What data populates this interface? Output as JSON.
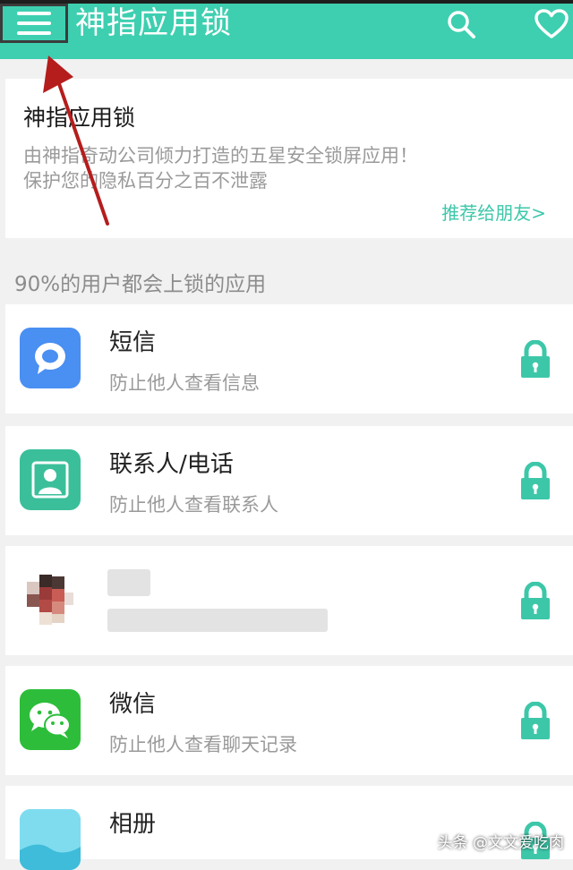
{
  "header": {
    "title": "神指应用锁",
    "menu_icon": "menu-icon",
    "search_icon": "search-icon",
    "heart_icon": "heart-icon",
    "background_color": "#3dcfb0"
  },
  "intro": {
    "title": "神指应用锁",
    "description": "由神指奇动公司倾力打造的五星安全锁屏应用！\n保护您的隐私百分之百不泄露",
    "share_link": "推荐给朋友>"
  },
  "section_label": "90%的用户都会上锁的应用",
  "apps": [
    {
      "name": "短信",
      "subtitle": "防止他人查看信息",
      "icon": "message-icon",
      "locked": true
    },
    {
      "name": "联系人/电话",
      "subtitle": "防止他人查看联系人",
      "icon": "contacts-icon",
      "locked": true
    },
    {
      "name": "",
      "subtitle": "",
      "icon": "blurred-avatar-icon",
      "locked": true
    },
    {
      "name": "微信",
      "subtitle": "防止他人查看聊天记录",
      "icon": "wechat-icon",
      "locked": true
    },
    {
      "name": "相册",
      "subtitle": "",
      "icon": "gallery-icon",
      "locked": true
    }
  ],
  "lock_color": "#3dc7a9",
  "watermark": "头条 @文文爱吃肉"
}
